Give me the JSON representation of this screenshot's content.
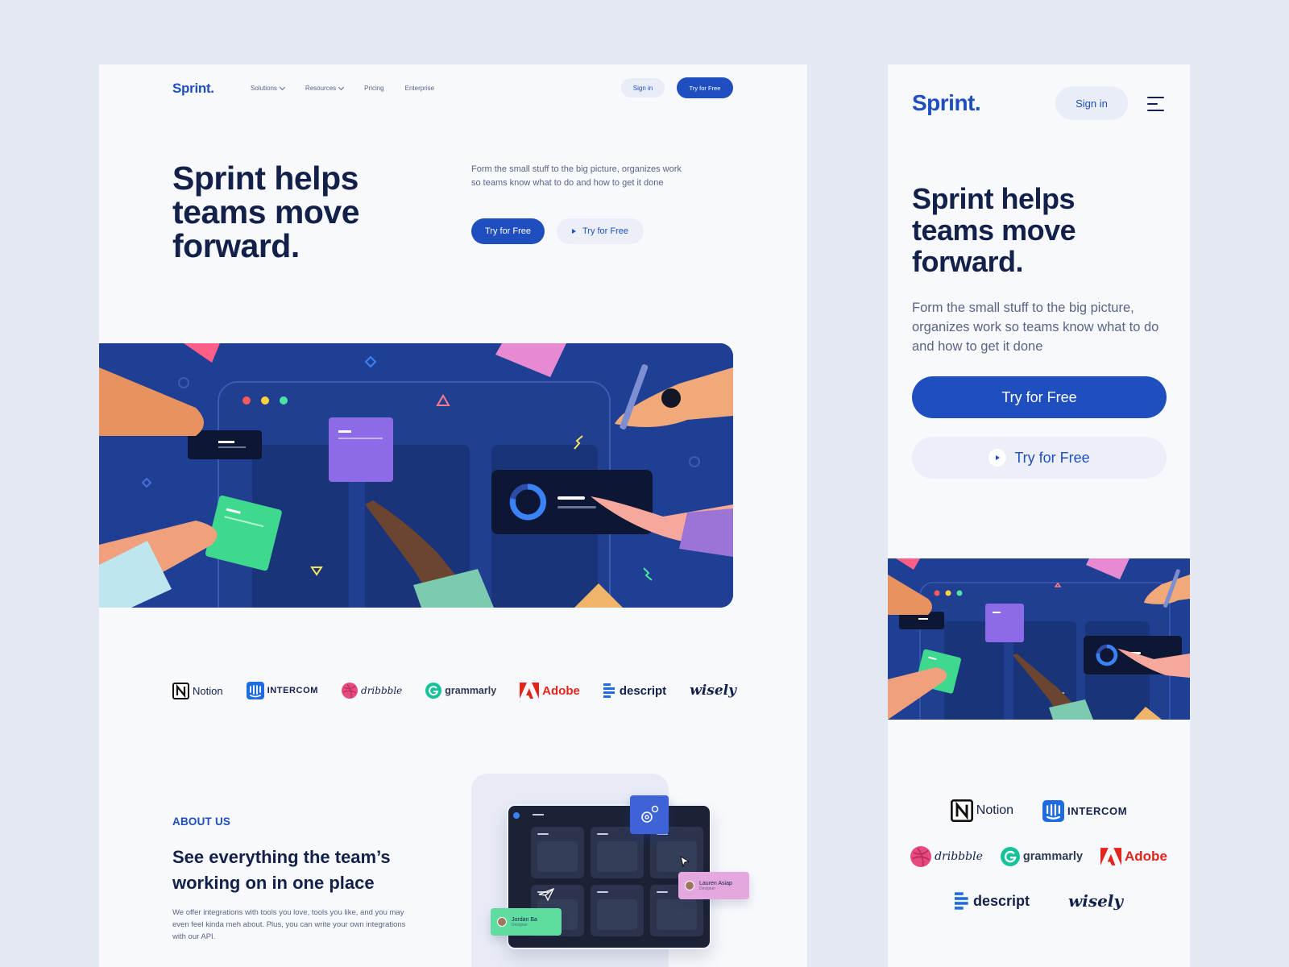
{
  "brand": {
    "logo": "Sprint.",
    "accent": "#1f4fbf",
    "ink": "#13214a"
  },
  "desktop": {
    "nav": {
      "items": [
        {
          "label": "Solutions",
          "has_dropdown": true
        },
        {
          "label": "Resources",
          "has_dropdown": true
        },
        {
          "label": "Pricing",
          "has_dropdown": false
        },
        {
          "label": "Enterprise",
          "has_dropdown": false
        }
      ],
      "signin_label": "Sign in",
      "cta_label": "Try for Free"
    },
    "hero": {
      "title": "Sprint helps teams move forward.",
      "description": "Form the small stuff to the big picture, organizes work so teams know what to do and how to get it done",
      "primary_label": "Try for Free",
      "secondary_label": "Try for Free"
    },
    "about": {
      "kicker": "ABOUT US",
      "title": "See everything the team’s working on in one place",
      "description": "We offer integrations with tools you love, tools you like, and you may even feel kinda meh about. Plus, you can write your own integrations with our API.",
      "tags": [
        {
          "name": "Jordan Ba",
          "role": "Designer"
        },
        {
          "name": "Lauren Asiap",
          "role": "Designer"
        }
      ]
    }
  },
  "mobile": {
    "signin_label": "Sign in",
    "hero": {
      "title": "Sprint helps teams move forward.",
      "description": "Form the small stuff to the big picture, organizes work so teams know what to do and how to get it done",
      "primary_label": "Try for Free",
      "secondary_label": "Try for Free"
    }
  },
  "partners": [
    {
      "name": "Notion",
      "icon": "notion-icon"
    },
    {
      "name": "INTERCOM",
      "icon": "intercom-icon"
    },
    {
      "name": "dribbble",
      "icon": "dribbble-icon"
    },
    {
      "name": "grammarly",
      "icon": "grammarly-icon"
    },
    {
      "name": "Adobe",
      "icon": "adobe-icon"
    },
    {
      "name": "descript",
      "icon": "descript-icon"
    },
    {
      "name": "wisely",
      "icon": "wisely-icon"
    }
  ]
}
